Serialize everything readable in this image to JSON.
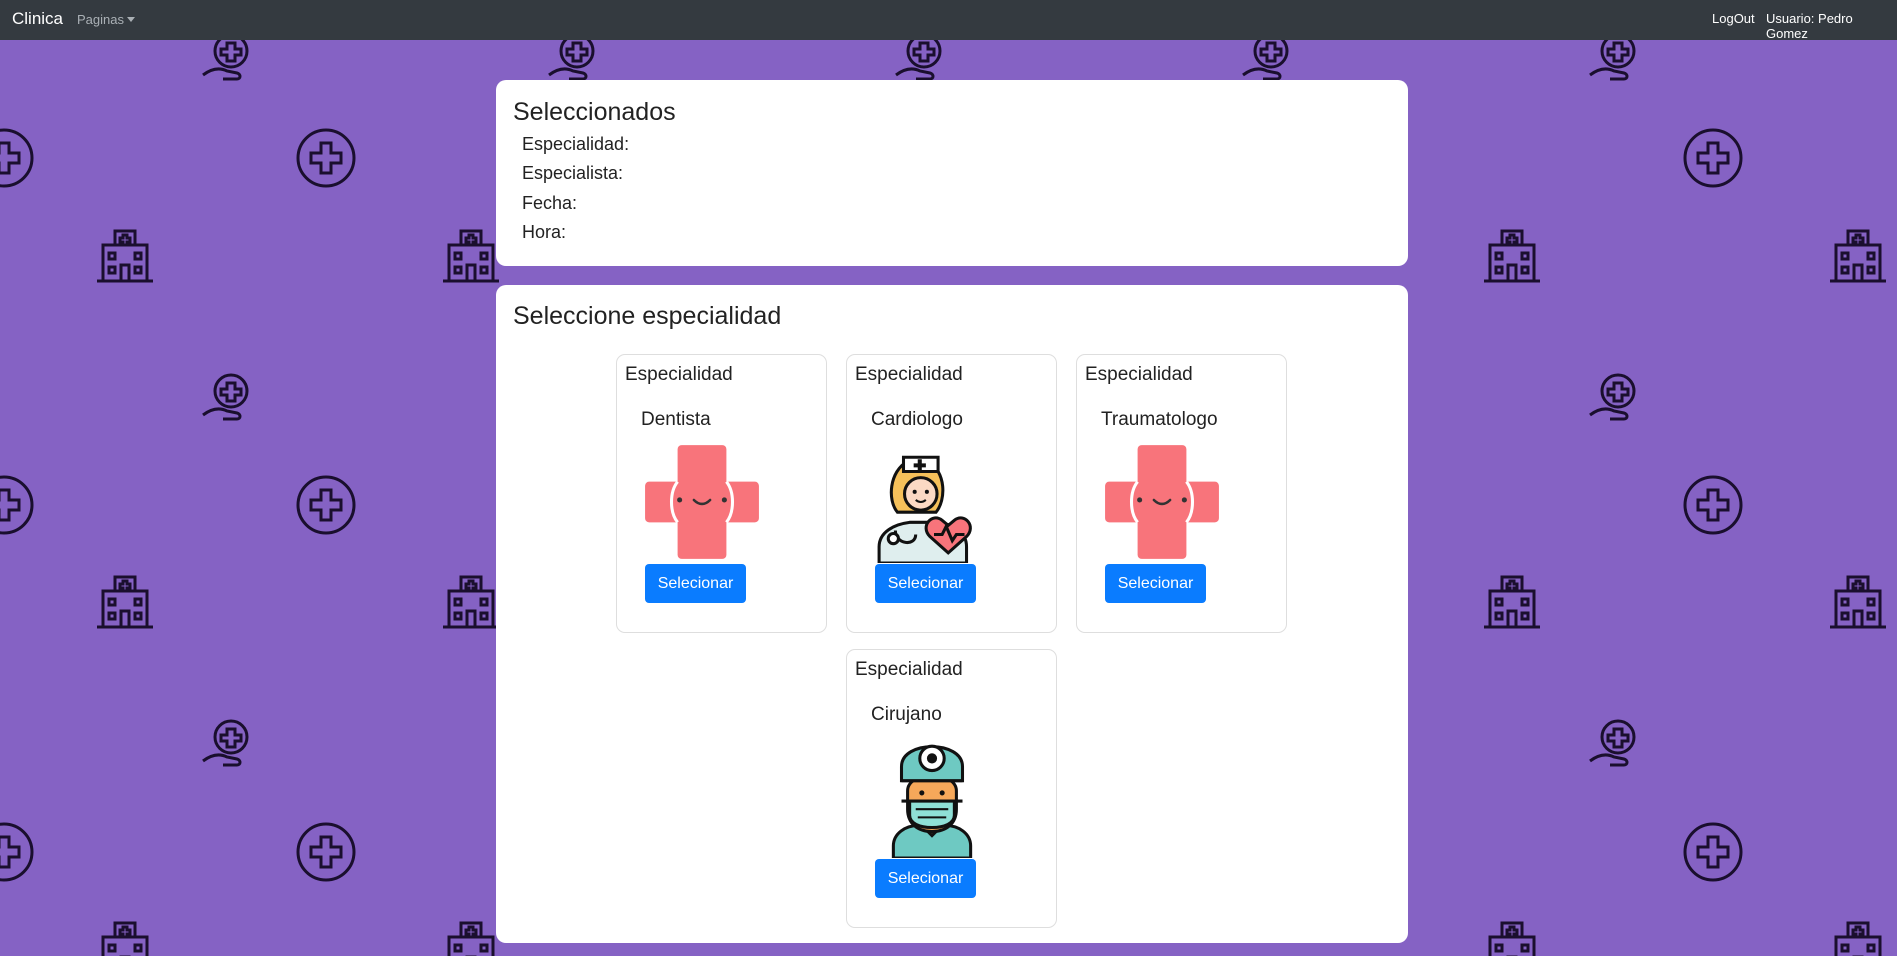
{
  "navbar": {
    "brand": "Clinica",
    "pages_menu": "Paginas",
    "logout": "LogOut",
    "user": "Usuario: Pedro Gomez"
  },
  "seleccionados": {
    "title": "Seleccionados",
    "rows": [
      "Especialidad:",
      "Especialista:",
      "Fecha:",
      "Hora:"
    ]
  },
  "especialidad_panel": {
    "title": "Seleccione especialidad",
    "cards": [
      {
        "header": "Especialidad",
        "name": "Dentista",
        "icon": "red-cross-smile-icon",
        "button": "Selecionar"
      },
      {
        "header": "Especialidad",
        "name": "Cardiologo",
        "icon": "nurse-heart-icon",
        "button": "Selecionar"
      },
      {
        "header": "Especialidad",
        "name": "Traumatologo",
        "icon": "red-cross-smile-icon",
        "button": "Selecionar"
      },
      {
        "header": "Especialidad",
        "name": "Cirujano",
        "icon": "surgeon-icon",
        "button": "Selecionar"
      }
    ]
  },
  "colors": {
    "background": "#8562c4",
    "navbar": "#343a40",
    "button": "#0a7cff",
    "cross": "#f8747b"
  }
}
